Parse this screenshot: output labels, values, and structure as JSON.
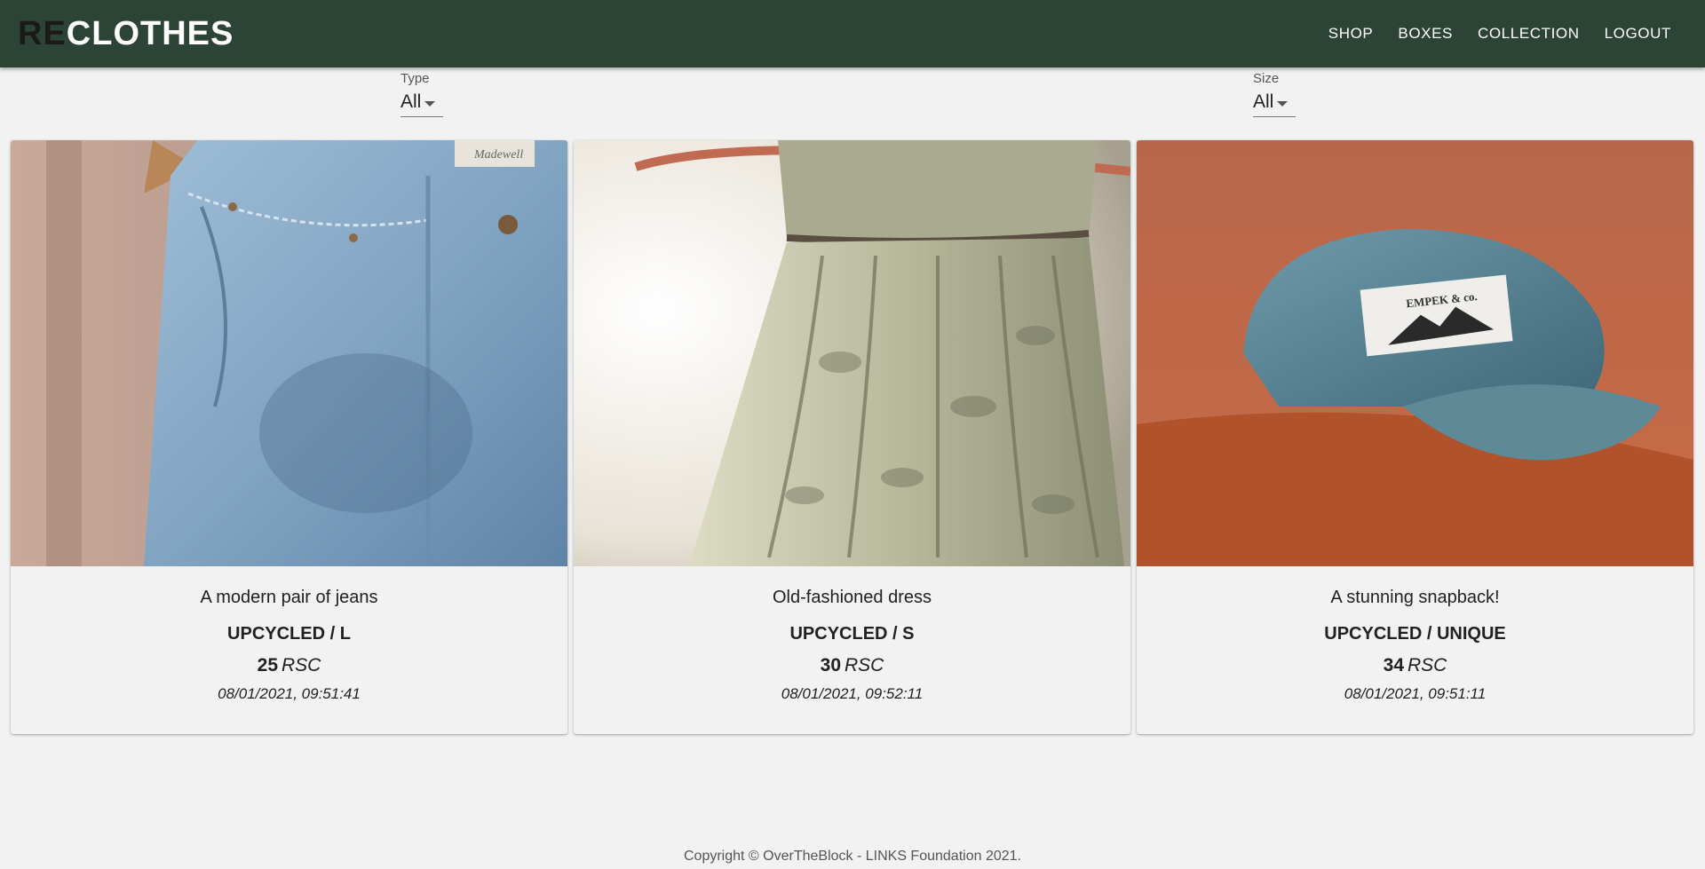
{
  "header": {
    "logo": {
      "prefix": "RE",
      "rest": "CLOTHES"
    },
    "nav": [
      "SHOP",
      "BOXES",
      "COLLECTION",
      "LOGOUT"
    ]
  },
  "filters": {
    "type": {
      "label": "Type",
      "value": "All"
    },
    "size": {
      "label": "Size",
      "value": "All"
    }
  },
  "items": [
    {
      "title": "A modern pair of jeans",
      "condition": "UPCYCLED",
      "size": "L",
      "price": "25",
      "currency": "RSC",
      "date": "08/01/2021, 09:51:41",
      "image": "jeans-photo"
    },
    {
      "title": "Old-fashioned dress",
      "condition": "UPCYCLED",
      "size": "S",
      "price": "30",
      "currency": "RSC",
      "date": "08/01/2021, 09:52:11",
      "image": "dress-photo"
    },
    {
      "title": "A stunning snapback!",
      "condition": "UPCYCLED",
      "size": "UNIQUE",
      "price": "34",
      "currency": "RSC",
      "date": "08/01/2021, 09:51:11",
      "image": "cap-photo"
    }
  ],
  "meta_separator": "/",
  "cap_patch_text": "EMPEK & co.",
  "jeans_label_text": "Madewell",
  "footer": {
    "copyright": "Copyright © OverTheBlock - LINKS Foundation 2021."
  },
  "colors": {
    "appbar": "#2b4436",
    "background": "#f2f2f2"
  }
}
